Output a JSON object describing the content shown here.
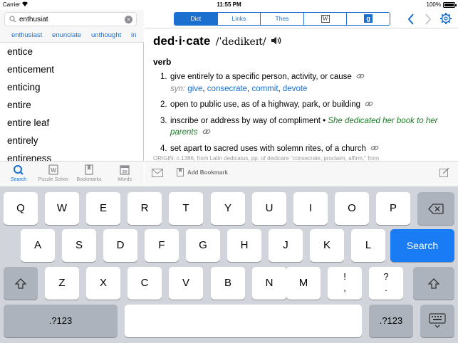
{
  "status": {
    "carrier": "Carrier",
    "time": "11:55 PM",
    "battery": "100%"
  },
  "search": {
    "value": "enthusiat",
    "placeholder": ""
  },
  "suggestions": [
    "enthusiast",
    "enunciate",
    "unthought",
    "in"
  ],
  "words": [
    "entice",
    "enticement",
    "enticing",
    "entire",
    "entire leaf",
    "entirely",
    "entireness"
  ],
  "tabs": [
    {
      "label": "Search",
      "icon": "search-icon",
      "active": true
    },
    {
      "label": "Puzzle Solver",
      "icon": "puzzle-icon",
      "active": false
    },
    {
      "label": "Bookmarks",
      "icon": "bookmark-icon",
      "active": false
    },
    {
      "label": "Words",
      "icon": "calendar-icon",
      "active": false
    }
  ],
  "segments": {
    "dict": "Dict",
    "links": "Links",
    "thes": "Thes",
    "wiki": "W",
    "google": "g"
  },
  "entry": {
    "headword": "ded·i·cate",
    "pronunciation": "/ˈdedikeɪt/",
    "part_of_speech": "verb",
    "senses": [
      {
        "num": "1.",
        "text": "give entirely to a specific person, activity, or cause",
        "syn_label": "syn:",
        "synonyms": [
          "give",
          "consecrate",
          "commit",
          "devote"
        ]
      },
      {
        "num": "2.",
        "text": "open to public use, as of a highway, park, or building"
      },
      {
        "num": "3.",
        "text": "inscribe or address by way of compliment",
        "example": "She dedicated her book to her parents"
      },
      {
        "num": "4.",
        "text": "set apart to sacred uses with solemn rites, of a church"
      }
    ],
    "origin": "ORIGIN: c.1386, from Latin dedicatus, pp. of dedicare \"consecrate, proclaim, affirm,\" from"
  },
  "bottom": {
    "add_bookmark": "Add Bookmark"
  },
  "keyboard": {
    "row1": [
      "Q",
      "W",
      "E",
      "R",
      "T",
      "Y",
      "U",
      "I",
      "O",
      "P"
    ],
    "row2": [
      "A",
      "S",
      "D",
      "F",
      "G",
      "H",
      "J",
      "K",
      "L"
    ],
    "row3": [
      "Z",
      "X",
      "C",
      "V",
      "B",
      "N",
      "M"
    ],
    "punct1": "!",
    "punct1b": ",",
    "punct2": "?",
    "punct2b": ".",
    "search_key": "Search",
    "numbers_key": ".?123"
  },
  "colors": {
    "accent": "#1a6fcf",
    "example": "#1f7a2a",
    "keyboard_bg": "#d1d5db",
    "search_key": "#1a7cf5"
  }
}
